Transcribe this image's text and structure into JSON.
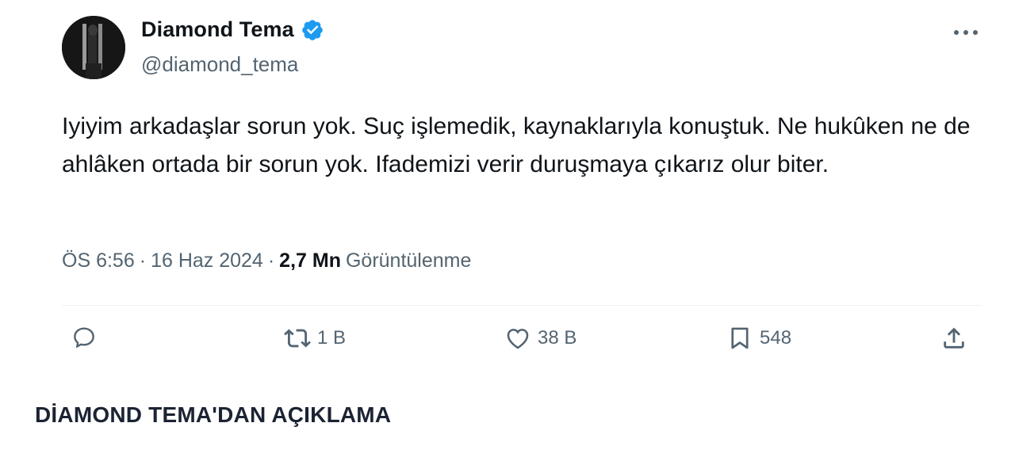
{
  "tweet": {
    "author": {
      "display_name": "Diamond Tema",
      "handle": "@diamond_tema",
      "verified": true
    },
    "text": "Iyiyim arkadaşlar sorun yok. Suç işlemedik, kaynaklarıyla konuştuk. Ne hukûken ne de ahlâken ortada bir sorun yok. Ifademizi verir duruşmaya çıkarız olur biter.",
    "time": "ÖS 6:56",
    "date": "16 Haz 2024",
    "separator": "·",
    "views_count": "2,7 Mn",
    "views_label": "Görüntülenme",
    "actions": {
      "reply_count": "",
      "retweet_count": "1 B",
      "like_count": "38 B",
      "bookmark_count": "548"
    }
  },
  "caption": "DİAMOND TEMA'DAN AÇIKLAMA",
  "colors": {
    "text_primary": "#0f1419",
    "text_secondary": "#536471",
    "verified_blue": "#1d9bf0",
    "divider": "#eff3f4"
  },
  "icons": [
    "verified-badge-icon",
    "more-icon",
    "reply-icon",
    "retweet-icon",
    "like-icon",
    "bookmark-icon",
    "share-icon"
  ]
}
